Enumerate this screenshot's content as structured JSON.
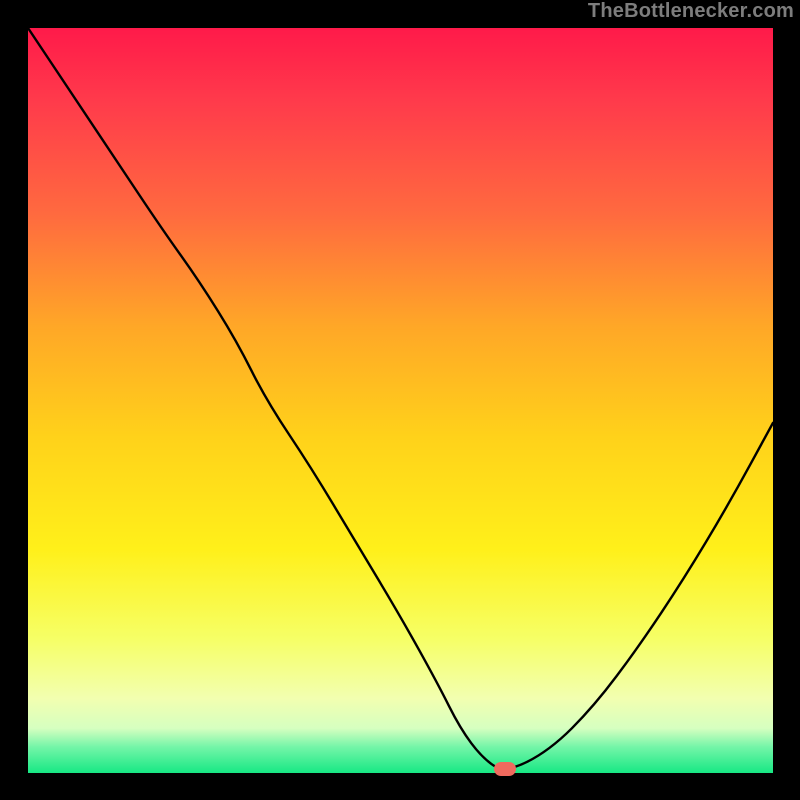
{
  "watermark": "TheBottlenecker.com",
  "colors": {
    "frame": "#000000",
    "curve": "#000000",
    "marker": "#ef6a5e",
    "gradient_stops": [
      {
        "offset": 0.0,
        "color": "#ff1a4a"
      },
      {
        "offset": 0.1,
        "color": "#ff3b4b"
      },
      {
        "offset": 0.25,
        "color": "#ff6a3f"
      },
      {
        "offset": 0.4,
        "color": "#ffa727"
      },
      {
        "offset": 0.55,
        "color": "#ffd21a"
      },
      {
        "offset": 0.7,
        "color": "#fff01a"
      },
      {
        "offset": 0.82,
        "color": "#f6ff66"
      },
      {
        "offset": 0.9,
        "color": "#f2ffb0"
      },
      {
        "offset": 0.94,
        "color": "#d6ffc0"
      },
      {
        "offset": 0.965,
        "color": "#74f5a8"
      },
      {
        "offset": 1.0,
        "color": "#17e884"
      }
    ]
  },
  "chart_data": {
    "type": "line",
    "title": "",
    "xlabel": "",
    "ylabel": "",
    "xlim": [
      0,
      100
    ],
    "ylim": [
      0,
      100
    ],
    "series": [
      {
        "name": "bottleneck-curve",
        "x": [
          0,
          6,
          12,
          18,
          23,
          28,
          32,
          38,
          44,
          50,
          55,
          58,
          61,
          64,
          70,
          76,
          82,
          88,
          94,
          100
        ],
        "y": [
          100,
          91,
          82,
          73,
          66,
          58,
          50,
          41,
          31,
          21,
          12,
          6,
          2,
          0,
          3,
          9,
          17,
          26,
          36,
          47
        ]
      }
    ],
    "marker": {
      "x": 64,
      "y": 0,
      "name": "optimum-point"
    },
    "note": "x/y are percentages of the plot area; y=0 at bottom (green), y=100 at top (red)."
  }
}
